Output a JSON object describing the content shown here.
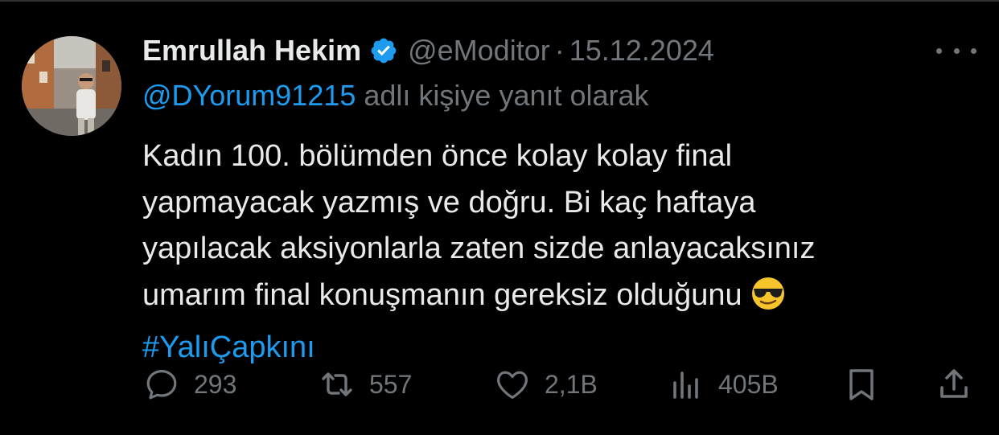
{
  "tweet": {
    "author_name": "Emrullah Hekim",
    "handle": "@eModitor",
    "separator": "·",
    "date": "15.12.2024",
    "reply_to_handle": "@DYorum91215",
    "reply_to_suffix": "adlı kişiye yanıt olarak",
    "lines": [
      "Kadın 100. bölümden önce kolay kolay final",
      "yapmayacak yazmış ve doğru. Bi kaç haftaya",
      "yapılacak aksiyonlarla zaten sizde anlayacaksınız",
      "umarım final konuşmanın gereksiz olduğunu"
    ],
    "hashtag": "#YalıÇapkını"
  },
  "actions": {
    "replies": "293",
    "retweets": "557",
    "likes": "2,1B",
    "views": "405B"
  },
  "icons": {
    "verified": "verified-badge-icon",
    "more": "more-dots-icon",
    "reply": "reply-bubble-icon",
    "retweet": "retweet-icon",
    "like": "heart-icon",
    "views": "views-bars-icon",
    "bookmark": "bookmark-icon",
    "share": "share-icon",
    "emoji": "sunglasses-emoji-icon"
  },
  "colors": {
    "background": "#000000",
    "text": "#e7e9ea",
    "muted": "#71767b",
    "accent": "#1d9bf0"
  }
}
